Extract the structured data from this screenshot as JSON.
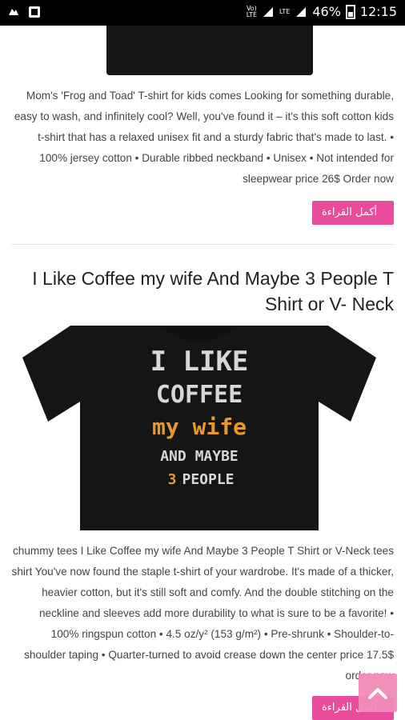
{
  "status_bar": {
    "network_label_1": "Vo)",
    "network_label_2": "LTE",
    "lte_label": "LTE",
    "battery_percent": "46%",
    "time": "12:15"
  },
  "post_1": {
    "description": "Mom's 'Frog and Toad' T-shirt for kids comes Looking for something durable, easy to wash, and infinitely cool? Well, you've found it – it's this soft cotton kids t-shirt that has a relaxed unisex fit and a sturdy fabric that's made to last. • 100% jersey cotton • Durable ribbed neckband • Unisex • Not intended for sleepwear price 26$ Order now",
    "read_more": "أكمل القراءة »"
  },
  "post_2": {
    "title": "I Like Coffee my wife And Maybe 3 People T Shirt or V- Neck",
    "shirt_text": {
      "line1": "I LIKE",
      "line2": "COFFEE",
      "line3": "my wife",
      "line4": "AND MAYBE",
      "line5_num": "3",
      "line5_rest": "PEOPLE"
    },
    "description": "chummy tees I Like Coffee my wife And Maybe 3 People T Shirt or V-Neck tees shirt You've now found the staple t-shirt of your wardrobe. It's made of a thicker, heavier cotton, but it's still soft and comfy. And the double stitching on the neckline and sleeves add more durability to what is sure to be a favorite! • 100% ringspun cotton • 4.5 oz/y² (153 g/m²) • Pre-shrunk • Shoulder-to-shoulder taping • Quarter-turned to avoid crease down the center price 17.5$ order now",
    "read_more": "أكمل القراءة »"
  },
  "colors": {
    "accent_pink": "#ea4c9c",
    "shirt_black": "#151515",
    "shirt_orange": "#e69a2e"
  },
  "icons": {
    "scroll_top": "chevron-up-icon"
  }
}
